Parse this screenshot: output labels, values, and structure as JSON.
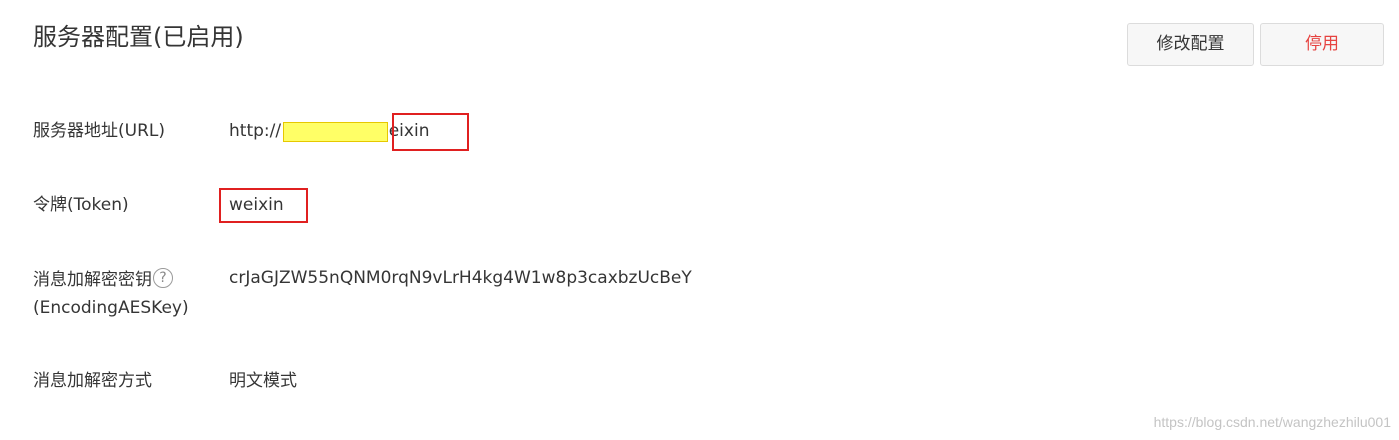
{
  "header": {
    "title": "服务器配置(已启用)",
    "edit_label": "修改配置",
    "disable_label": "停用"
  },
  "rows": {
    "url": {
      "label": "服务器地址(URL)",
      "value_prefix": "http://",
      "value_suffix": "/weixin"
    },
    "token": {
      "label": "令牌(Token)",
      "value": "weixin"
    },
    "aes_key": {
      "label_line1": "消息加解密密钥",
      "label_line2": "(EncodingAESKey)",
      "help_glyph": "?",
      "value": "crJaGJZW55nQNM0rqN9vLrH4kg4W1w8p3caxbzUcBeY"
    },
    "encryption_mode": {
      "label": "消息加解密方式",
      "value": "明文模式"
    }
  },
  "watermark": "https://blog.csdn.net/wangzhezhilu001",
  "colors": {
    "text": "#353535",
    "danger": "#e64340",
    "annotation_red": "#e02020",
    "redaction_yellow": "#ffff66"
  },
  "icons": {
    "help": "question-circle-icon"
  }
}
